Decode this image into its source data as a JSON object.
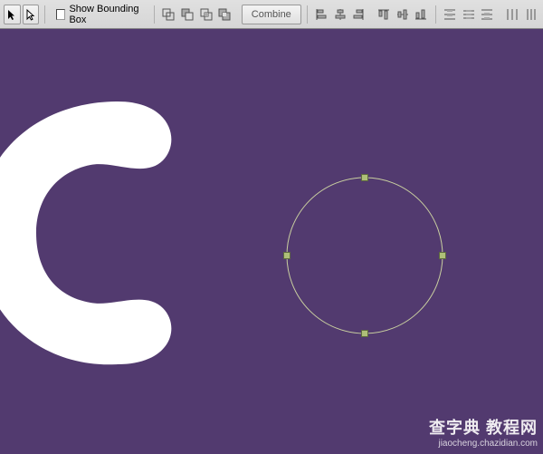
{
  "toolbar": {
    "checkbox_label": "Show Bounding Box",
    "combine_label": "Combine"
  },
  "colors": {
    "canvas_bg": "#523A6F",
    "shape_fill": "#FFFFFF",
    "selection_stroke": "#c9cfa0",
    "handle_fill": "#aebf78"
  },
  "watermark": {
    "title": "查字典 教程网",
    "url": "jiaocheng.chazidian.com"
  }
}
